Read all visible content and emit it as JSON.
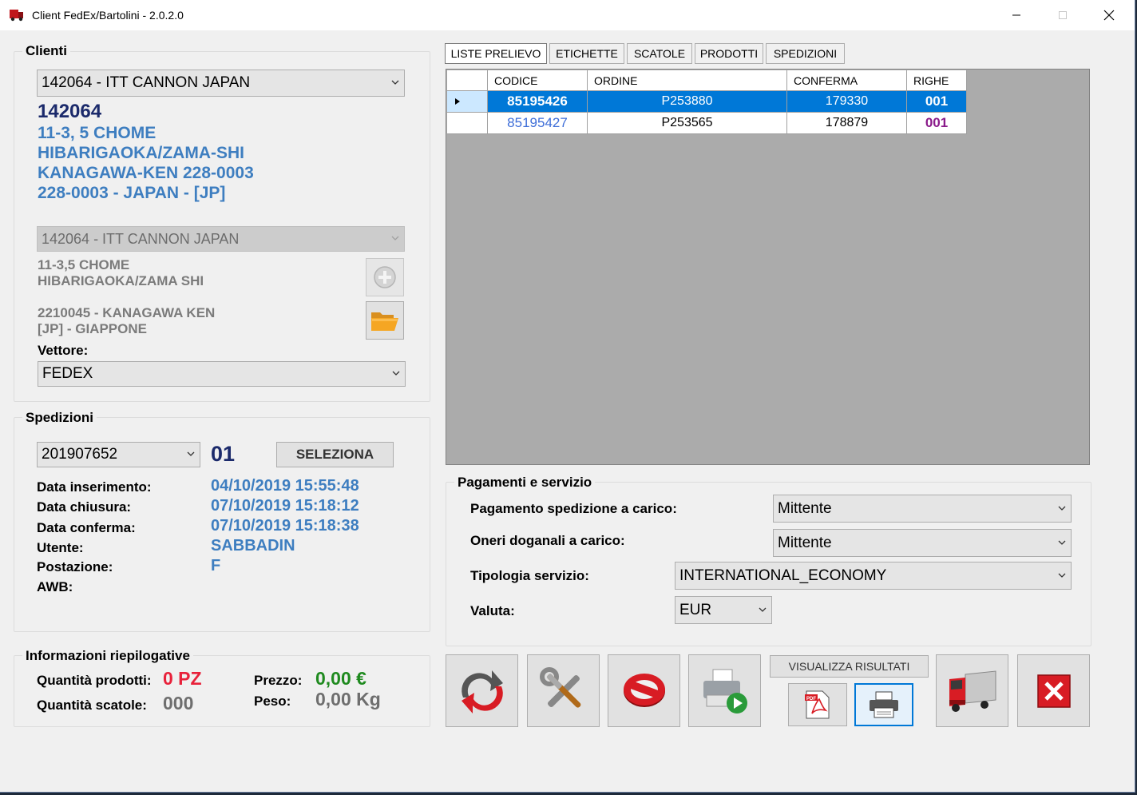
{
  "window": {
    "title": "Client FedEx/Bartolini - 2.0.2.0"
  },
  "clienti": {
    "group_title": "Clienti",
    "selected": "142064 - ITT CANNON JAPAN",
    "code": "142064",
    "address_lines": [
      "11-3, 5 CHOME",
      "HIBARIGAOKA/ZAMA-SHI",
      "KANAGAWA-KEN 228-0003",
      "228-0003 - JAPAN - [JP]"
    ],
    "dest_selected": "142064 - ITT CANNON JAPAN",
    "dest_lines_1": [
      "11-3,5 CHOME",
      "HIBARIGAOKA/ZAMA SHI"
    ],
    "dest_lines_2": [
      "2210045 - KANAGAWA KEN",
      "[JP] - GIAPPONE"
    ],
    "vettore_label": "Vettore:",
    "vettore_value": "FEDEX"
  },
  "spedizioni": {
    "group_title": "Spedizioni",
    "selected": "201907652",
    "number": "01",
    "seleziona_label": "SELEZIONA",
    "rows": [
      {
        "label": "Data inserimento:",
        "value": "04/10/2019 15:55:48"
      },
      {
        "label": "Data chiusura:",
        "value": "07/10/2019 15:18:12"
      },
      {
        "label": "Data conferma:",
        "value": "07/10/2019 15:18:38"
      },
      {
        "label": "Utente:",
        "value": "SABBADIN"
      },
      {
        "label": "Postazione:",
        "value": "F"
      },
      {
        "label": "AWB:",
        "value": ""
      }
    ]
  },
  "riepilogo": {
    "group_title": "Informazioni riepilogative",
    "qty_products_label": "Quantità prodotti:",
    "qty_products_value": "0 PZ",
    "qty_boxes_label": "Quantità scatole:",
    "qty_boxes_value": "000",
    "price_label": "Prezzo:",
    "price_value": "0,00 €",
    "weight_label": "Peso:",
    "weight_value": "0,00 Kg"
  },
  "tabs": [
    "LISTE PRELIEVO",
    "ETICHETTE",
    "SCATOLE",
    "PRODOTTI",
    "SPEDIZIONI"
  ],
  "table": {
    "columns": [
      "CODICE",
      "ORDINE",
      "CONFERMA",
      "RIGHE"
    ],
    "rows": [
      {
        "codice": "85195426",
        "ordine": "P253880",
        "conferma": "179330",
        "righe": "001"
      },
      {
        "codice": "85195427",
        "ordine": "P253565",
        "conferma": "178879",
        "righe": "001"
      }
    ]
  },
  "pagamenti": {
    "group_title": "Pagamenti e servizio",
    "pagamento_label": "Pagamento spedizione a carico:",
    "pagamento_value": "Mittente",
    "oneri_label": "Oneri doganali a carico:",
    "oneri_value": "Mittente",
    "tipologia_label": "Tipologia servizio:",
    "tipologia_value": "INTERNATIONAL_ECONOMY",
    "valuta_label": "Valuta:",
    "valuta_value": "EUR"
  },
  "actions": {
    "visualizza_label": "VISUALIZZA RISULTATI"
  },
  "colors": {
    "accent": "#0078d7",
    "blue_text": "#3e7ec0",
    "red_value": "#e8213a",
    "green_value": "#1f8a1f"
  }
}
